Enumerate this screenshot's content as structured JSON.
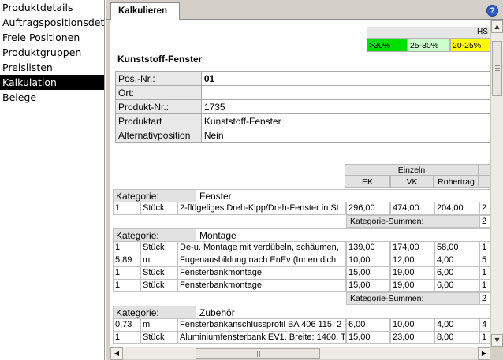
{
  "sidebar": {
    "items": [
      {
        "label": "Produktdetails"
      },
      {
        "label": "Auftragspositionsdet"
      },
      {
        "label": "Freie Positionen"
      },
      {
        "label": "Produktgruppen"
      },
      {
        "label": "Preislisten"
      },
      {
        "label": "Kalkulation",
        "active": true
      },
      {
        "label": "Belege"
      }
    ]
  },
  "tabs": {
    "active_label": "Kalkulieren",
    "help_symbol": "?"
  },
  "legend": {
    "header": "HS",
    "items": [
      {
        "label": ">30%",
        "color": "#00e000"
      },
      {
        "label": "25-30%",
        "color": "#ccffcc"
      },
      {
        "label": "20-25%",
        "color": "#ffff00"
      }
    ]
  },
  "product": {
    "title": "Kunststoff-Fenster",
    "fields": [
      {
        "label": "Pos.-Nr.:",
        "value": "01"
      },
      {
        "label": "Ort:",
        "value": ""
      },
      {
        "label": "Produkt-Nr.:",
        "value": "1735"
      },
      {
        "label": "Produktart",
        "value": "Kunststoff-Fenster"
      },
      {
        "label": "Alternativposition",
        "value": "Nein"
      }
    ]
  },
  "table": {
    "group_header": "Einzeln",
    "columns": [
      "EK",
      "VK",
      "Rohertrag"
    ],
    "category_label": "Kategorie:",
    "sum_label": "Kategorie-Summen:",
    "categories": [
      {
        "name": "Fenster",
        "rows": [
          {
            "qty": "1",
            "unit": "Stück",
            "desc": "2-flügeliges Dreh-Kipp/Dreh-Fenster in St",
            "ek": "296,00",
            "vk": "474,00",
            "rt": "204,00",
            "x": "2"
          }
        ],
        "sum_x": "2"
      },
      {
        "name": "Montage",
        "rows": [
          {
            "qty": "1",
            "unit": "Stück",
            "desc": "De-u. Montage mit verdübeln, schäumen,",
            "ek": "139,00",
            "vk": "174,00",
            "rt": "58,00",
            "x": "1"
          },
          {
            "qty": "5,89",
            "unit": "m",
            "desc": "Fugenausbildung nach EnEv (Innen dich",
            "ek": "10,00",
            "vk": "12,00",
            "rt": "4,00",
            "x": "5"
          },
          {
            "qty": "1",
            "unit": "Stück",
            "desc": "Fensterbankmontage",
            "ek": "15,00",
            "vk": "19,00",
            "rt": "6,00",
            "x": "1"
          },
          {
            "qty": "1",
            "unit": "Stück",
            "desc": "Fensterbankmontage",
            "ek": "15,00",
            "vk": "19,00",
            "rt": "6,00",
            "x": "1"
          }
        ],
        "sum_x": "2"
      },
      {
        "name": "Zubehör",
        "rows": [
          {
            "qty": "0,73",
            "unit": "m",
            "desc": "Fensterbankanschlussprofil BA 406 115, 2",
            "ek": "6,00",
            "vk": "10,00",
            "rt": "4,00",
            "x": "4"
          },
          {
            "qty": "1",
            "unit": "Stück",
            "desc": "Aluminiumfensterbank EV1, Breite: 1460, T",
            "ek": "15,00",
            "vk": "23,00",
            "rt": "8,00",
            "x": "1"
          }
        ]
      }
    ]
  },
  "scroll": {
    "up": "▲",
    "down": "▼",
    "left": "◀",
    "right": "▶"
  }
}
